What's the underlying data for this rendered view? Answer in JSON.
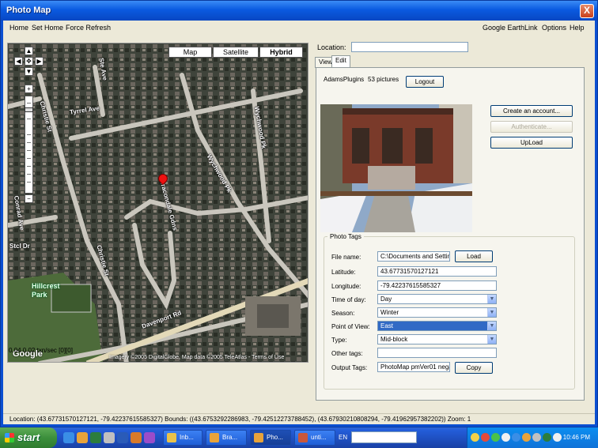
{
  "window": {
    "title": "Photo Map",
    "close_label": "X"
  },
  "menu": {
    "home": "Home",
    "set_home": "Set Home",
    "force_refresh": "Force Refresh",
    "google_earth": "Google Earth",
    "link": "Link",
    "options": "Options",
    "help": "Help"
  },
  "map": {
    "type_buttons": {
      "map": "Map",
      "satellite": "Satellite",
      "hybrid": "Hybrid"
    },
    "active_type": "Hybrid",
    "streets": {
      "tyrrel": "Tyrrel Ave",
      "christie": "Christie St",
      "christie2": "Christie St",
      "wychwood": "Wychwood Pk",
      "wychwood2": "Wychwood Pk",
      "bracondale": "Bracondale Gdns",
      "davenport": "Davenport Rd",
      "conrad": "Conrad Ave",
      "st_clair": "Stcl Dr",
      "arlington": "Ste Ave"
    },
    "park": "Hillcrest Park",
    "copyright": "Imagery ©2005 DigitalGlobe, Map data ©2005 TeleAtlas - Terms of Use",
    "logo": "Google",
    "readout": "0.04 0.02 txn/sec [0][0]"
  },
  "location": {
    "label": "Location:",
    "value": ""
  },
  "tabs": {
    "view": "View",
    "edit": "Edit"
  },
  "account": {
    "user": "AdamsPlugins",
    "count": "53 pictures",
    "logout": "Logout",
    "create": "Create an account...",
    "authenticate": "Authenticate...",
    "upload": "UpLoad"
  },
  "photo_tags": {
    "legend": "Photo Tags",
    "file_name": {
      "label": "File name:",
      "value": "C:\\Documents and Settin",
      "button": "Load"
    },
    "latitude": {
      "label": "Latitude:",
      "value": "43.67731570127121"
    },
    "longitude": {
      "label": "Longitude:",
      "value": "-79.42237615585327"
    },
    "time_of_day": {
      "label": "Time of day:",
      "value": "Day"
    },
    "season": {
      "label": "Season:",
      "value": "Winter"
    },
    "point_of_view": {
      "label": "Point of View:",
      "value": "East"
    },
    "type": {
      "label": "Type:",
      "value": "Mid-block"
    },
    "other_tags": {
      "label": "Other tags:",
      "value": ""
    },
    "output_tags": {
      "label": "Output Tags:",
      "value": "PhotoMap pmVer01 nega",
      "button": "Copy"
    }
  },
  "status": "Location: (43.67731570127121, -79.42237615585327) Bounds: ((43.6753292286983, -79.42512273788452), (43.67930210808294, -79.41962957382202)) Zoom: 1",
  "taskbar": {
    "start": "start",
    "tasks": [
      "Inb...",
      "Bra...",
      "Pho...",
      "unti..."
    ],
    "lang": "EN",
    "clock": "10:46 PM"
  },
  "colors": {
    "titlebar": "#0a5ae0",
    "taskbar": "#245edb",
    "start": "#3c8f3c",
    "selection": "#316ac5"
  }
}
